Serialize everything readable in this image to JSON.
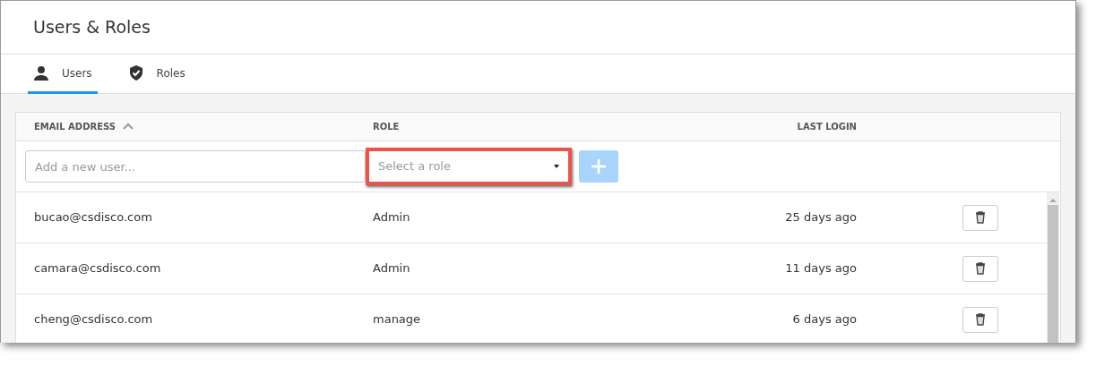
{
  "window": {
    "title": "Users & Roles"
  },
  "tabs": [
    {
      "label": "Users",
      "selected": true
    },
    {
      "label": "Roles",
      "selected": false
    }
  ],
  "table": {
    "columns": [
      {
        "label": "EMAIL ADDRESS",
        "sorted_ascending": true
      },
      {
        "label": "ROLE"
      },
      {
        "label": "LAST LOGIN"
      }
    ],
    "new_user": {
      "email_placeholder": "Add a new user...",
      "role_placeholder": "Select a role",
      "role_highlighted": true,
      "add_disabled": true
    },
    "rows": [
      {
        "email": "bucao@csdisco.com",
        "role": "Admin",
        "last_login": "25 days ago"
      },
      {
        "email": "camara@csdisco.com",
        "role": "Admin",
        "last_login": "11 days ago"
      },
      {
        "email": "cheng@csdisco.com",
        "role": "manage",
        "last_login": "6 days ago"
      }
    ]
  }
}
